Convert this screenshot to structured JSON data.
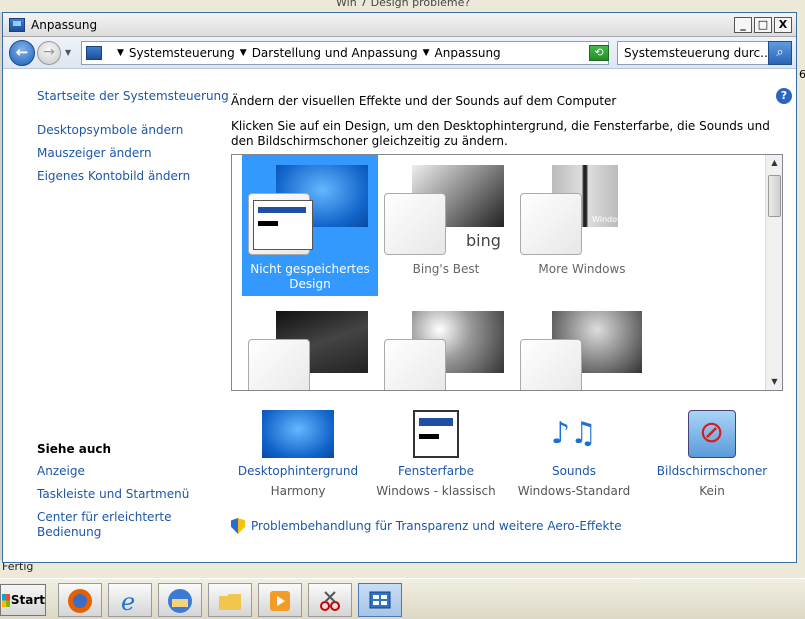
{
  "background": {
    "top_text": "Win 7 Design probleme?",
    "right_char": "6",
    "status": "Fertig"
  },
  "window": {
    "title": "Anpassung",
    "controls": {
      "minimize": "_",
      "maximize": "□",
      "close": "X"
    }
  },
  "address": {
    "crumbs": [
      "Systemsteuerung",
      "Darstellung und Anpassung",
      "Anpassung"
    ],
    "search_placeholder": "Systemsteuerung durc..."
  },
  "help_label": "?",
  "left_links": [
    "Startseite der Systemsteuerung",
    "Desktopsymbole ändern",
    "Mauszeiger ändern",
    "Eigenes Kontobild ändern"
  ],
  "see_also": {
    "title": "Siehe auch",
    "links": [
      "Anzeige",
      "Taskleiste und Startmenü",
      "Center für erleichterte Bedienung"
    ]
  },
  "main": {
    "heading": "Ändern der visuellen Effekte und der Sounds auf dem Computer",
    "description": "Klicken Sie auf ein Design, um den Desktophintergrund, die Fensterfarbe, die Sounds und den Bildschirmschoner gleichzeitig zu ändern.",
    "themes": [
      {
        "name": "Nicht gespeichertes Design",
        "selected": true
      },
      {
        "name": "Bing's Best",
        "selected": false
      },
      {
        "name": "More Windows",
        "selected": false
      }
    ],
    "theme_captions": {
      "bing": "bing",
      "windows": "Windows"
    }
  },
  "options": [
    {
      "label": "Desktophintergrund",
      "value": "Harmony"
    },
    {
      "label": "Fensterfarbe",
      "value": "Windows - klassisch"
    },
    {
      "label": "Sounds",
      "value": "Windows-Standard"
    },
    {
      "label": "Bildschirmschoner",
      "value": "Kein"
    }
  ],
  "troubleshoot": "Problembehandlung für Transparenz und weitere Aero-Effekte",
  "taskbar": {
    "start": "Start"
  },
  "colors": {
    "link": "#1c57a6",
    "selection": "#3399ff",
    "window_border": "#3a6ea5"
  }
}
